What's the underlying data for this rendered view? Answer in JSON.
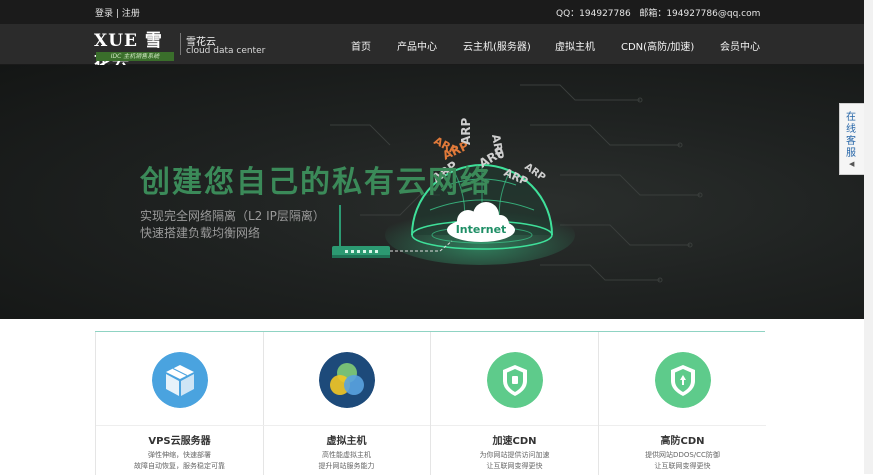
{
  "topbar": {
    "login": "登录",
    "sep": "|",
    "register": "注册",
    "qq_label": "QQ：",
    "qq": "194927786",
    "email_label": "邮箱：",
    "email": "194927786@qq.com"
  },
  "logo": {
    "brand": "XUE 雪花云",
    "sub": "IDC 主机销售系统",
    "name": "雪花云",
    "tagline": "cloud data center"
  },
  "nav": {
    "items": [
      "首页",
      "产品中心",
      "云主机(服务器)",
      "虚拟主机",
      "CDN(高防/加速)",
      "会员中心"
    ]
  },
  "hero": {
    "title": "创建您自己的私有云网络",
    "line1": "实现完全网络隔离（L2 IP层隔离）",
    "line2": "快速搭建负载均衡网络",
    "cloud_label": "Internet",
    "arp": [
      "ARP",
      "ARP",
      "ARP",
      "ARP",
      "ARP",
      "ARP",
      "ARP",
      "ARP"
    ]
  },
  "sidetab": {
    "label": "在线客服",
    "arrow": "◀"
  },
  "features": [
    {
      "title": "VPS云服务器",
      "line1": "弹性伸缩，快速部署",
      "line2": "故障自动恢复，服务稳定可靠",
      "icon": "cube-icon",
      "color": "#4aa3df"
    },
    {
      "title": "虚拟主机",
      "line1": "高性能虚拟主机",
      "line2": "提升网站服务能力",
      "icon": "venn-icon",
      "color": "#1d4a7a"
    },
    {
      "title": "加速CDN",
      "line1": "为你网站提供访问加速",
      "line2": "让互联网变得更快",
      "icon": "shield-icon",
      "color": "#5ecb8b"
    },
    {
      "title": "高防CDN",
      "line1": "提供网站DDOS/CC防御",
      "line2": "让互联网变得更快",
      "icon": "shield-icon",
      "color": "#5ecb8b"
    }
  ]
}
